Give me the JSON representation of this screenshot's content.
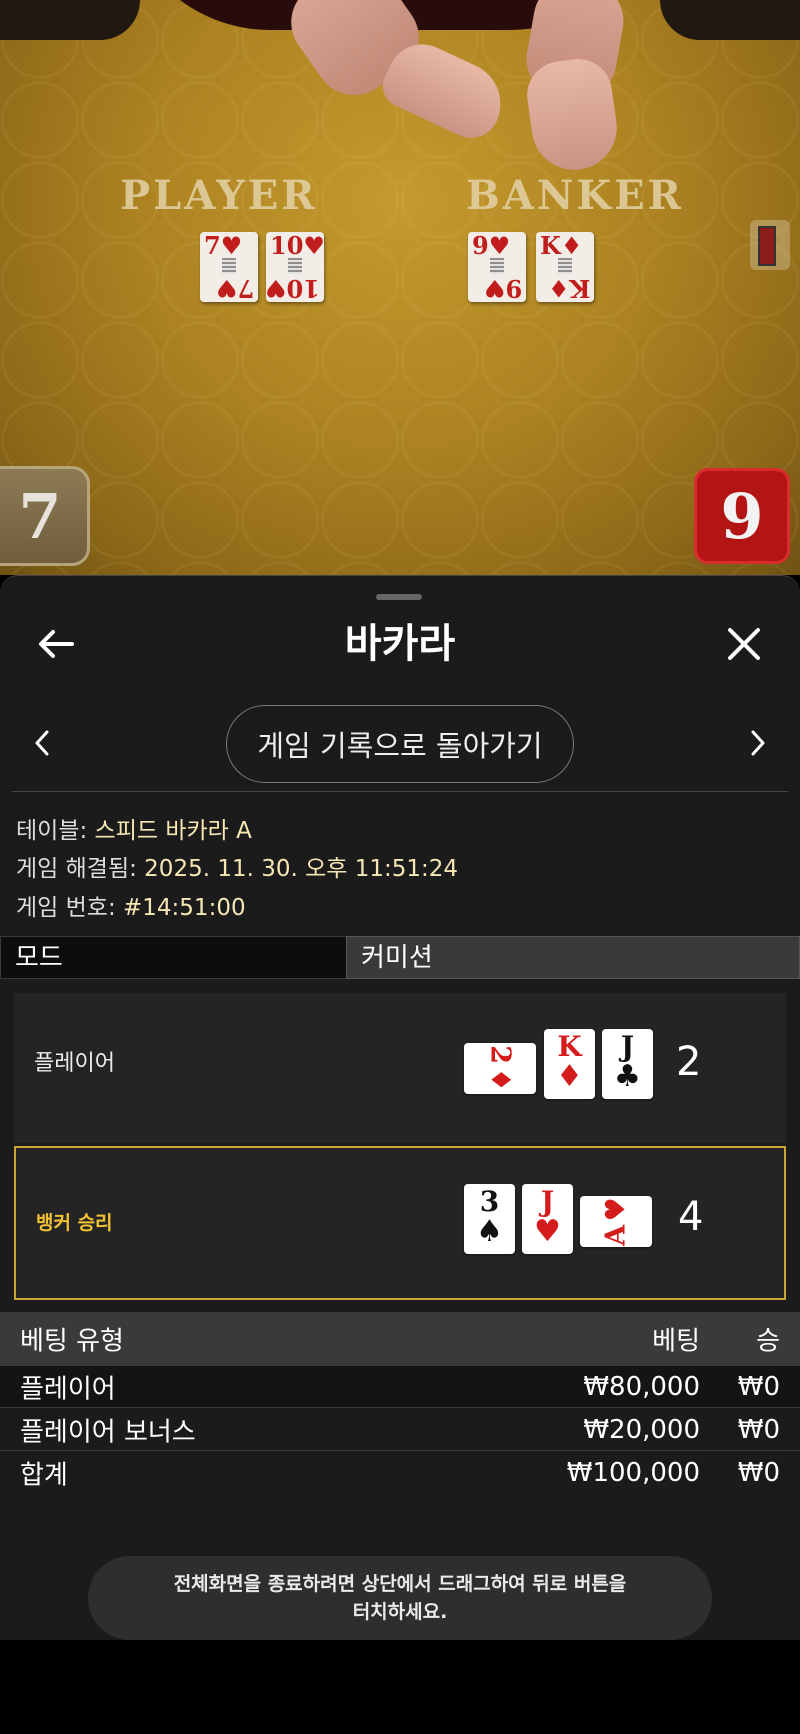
{
  "video": {
    "table_words": {
      "player": "PLAYER",
      "banker": "BANKER"
    },
    "player_cards": [
      {
        "rank": "7",
        "suit": "♥"
      },
      {
        "rank": "10",
        "suit": "♥"
      }
    ],
    "banker_cards": [
      {
        "rank": "9",
        "suit": "♥"
      },
      {
        "rank": "K",
        "suit": "♦"
      }
    ],
    "player_score": "7",
    "banker_score": "9"
  },
  "sheet": {
    "title": "바카라",
    "return_label": "게임 기록으로 돌아가기",
    "info": {
      "table_label": "테이블: ",
      "table_value": "스피드 바카라 A",
      "resolved_label": "게임 해결됨: ",
      "resolved_value": "2025. 11. 30. 오후 11:51:24",
      "number_label": "게임 번호: ",
      "number_value": "#14:51:00"
    },
    "mode_tabs": {
      "left": "모드",
      "right": "커미션"
    },
    "player_hand": {
      "label": "플레이어",
      "score": "2",
      "cards": [
        {
          "rank": "2",
          "suit": "♦",
          "color": "red",
          "orientation": "side"
        },
        {
          "rank": "K",
          "suit": "♦",
          "color": "red",
          "orientation": "up"
        },
        {
          "rank": "J",
          "suit": "♣",
          "color": "black",
          "orientation": "up"
        }
      ]
    },
    "banker_hand": {
      "label": "뱅커 승리",
      "score": "4",
      "cards": [
        {
          "rank": "3",
          "suit": "♠",
          "color": "black",
          "orientation": "up"
        },
        {
          "rank": "J",
          "suit": "♥",
          "color": "red",
          "orientation": "up"
        },
        {
          "rank": "A",
          "suit": "♥",
          "color": "red",
          "orientation": "side"
        }
      ]
    },
    "bets": {
      "headers": {
        "type": "베팅 유형",
        "bet": "베팅",
        "win": "승"
      },
      "rows": [
        {
          "type": "플레이어",
          "bet": "₩80,000",
          "win": "₩0"
        },
        {
          "type": "플레이어 보너스",
          "bet": "₩20,000",
          "win": "₩0"
        }
      ],
      "total": {
        "type": "합계",
        "bet": "₩100,000",
        "win": "₩0"
      }
    },
    "toast": {
      "line1": "전체화면을 종료하려면 상단에서 드래그하여 뒤로 버튼을",
      "line2": "터치하세요."
    }
  },
  "colors": {
    "sheet_bg": "#1b1b1b",
    "banker_highlight": "#c9a431",
    "banker_label": "#f2c233",
    "info_value": "#f7e7b4",
    "card_red": "#d51c1c"
  },
  "icons": {
    "back": "arrow-left-icon",
    "close": "close-icon",
    "prev": "chevron-left-icon",
    "next": "chevron-right-icon"
  }
}
